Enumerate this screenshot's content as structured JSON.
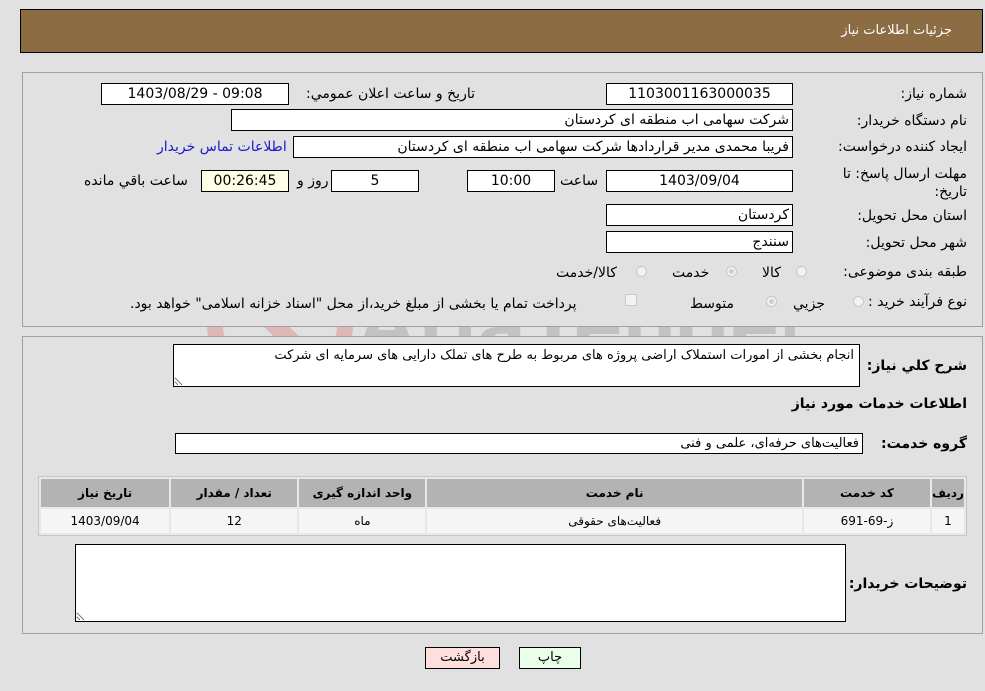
{
  "header": {
    "title": "جزئیات اطلاعات نیاز"
  },
  "form": {
    "need_number": {
      "label": "شماره نیاز:",
      "value": "1103001163000035"
    },
    "announce_datetime": {
      "label": "تاریخ و ساعت اعلان عمومي:",
      "value": "1403/08/29 - 09:08"
    },
    "buyer_org": {
      "label": "نام دستگاه خریدار:",
      "value": "شرکت سهامی اب منطقه ای کردستان"
    },
    "requester": {
      "label": "ایجاد کننده درخواست:",
      "value": "فریبا محمدی مدیر قراردادها شرکت سهامی اب منطقه ای کردستان"
    },
    "buyer_contact_link": "اطلاعات تماس خریدار",
    "deadline": {
      "label": "مهلت ارسال پاسخ: تا تاریخ:",
      "date": "1403/09/04",
      "time_label": "ساعت",
      "time": "10:00",
      "days": "5",
      "days_label": "روز و",
      "remaining": "00:26:45",
      "remaining_label": "ساعت باقي مانده"
    },
    "province": {
      "label": "استان محل تحویل:",
      "value": "کردستان"
    },
    "city": {
      "label": "شهر محل تحویل:",
      "value": "سنندج"
    },
    "category": {
      "label": "طبقه بندی موضوعی:",
      "options": [
        "کالا",
        "خدمت",
        "کالا/خدمت"
      ],
      "selected": "خدمت"
    },
    "purchase_type": {
      "label": "نوع فرآیند خرید :",
      "options": [
        "جزیي",
        "متوسط"
      ],
      "selected": "متوسط",
      "treasury_note": "پرداخت تمام یا بخشی از مبلغ خرید،از محل \"اسناد خزانه اسلامی\" خواهد بود."
    }
  },
  "details": {
    "description_label": "شرح كلي نیاز:",
    "description": "انجام بخشی از امورات استملاک اراضی پروژه های مربوط به طرح های تملک دارایی های سرمایه ای شرکت",
    "services_heading": "اطلاعات خدمات مورد نیاز",
    "service_group_label": "گروه خدمت:",
    "service_group": "فعالیت‌های حرفه‌ای، علمی و فنی",
    "table": {
      "headers": [
        "ردیف",
        "کد خدمت",
        "نام خدمت",
        "واحد اندازه گیری",
        "تعداد / مقدار",
        "تاریخ نیاز"
      ],
      "rows": [
        [
          "1",
          "ز-69-691",
          "فعالیت‌های حقوقی",
          "ماه",
          "12",
          "1403/09/04"
        ]
      ]
    },
    "buyer_notes_label": "توضیحات خریدار:",
    "buyer_notes": ""
  },
  "buttons": {
    "print": "چاپ",
    "back": "بازگشت"
  },
  "watermark": {
    "text": "AriaTender.neT"
  },
  "colors": {
    "header_bg": "#8c6d43",
    "print_bg": "#eaffea",
    "back_bg": "#ffdede",
    "link": "#1a1acc"
  }
}
